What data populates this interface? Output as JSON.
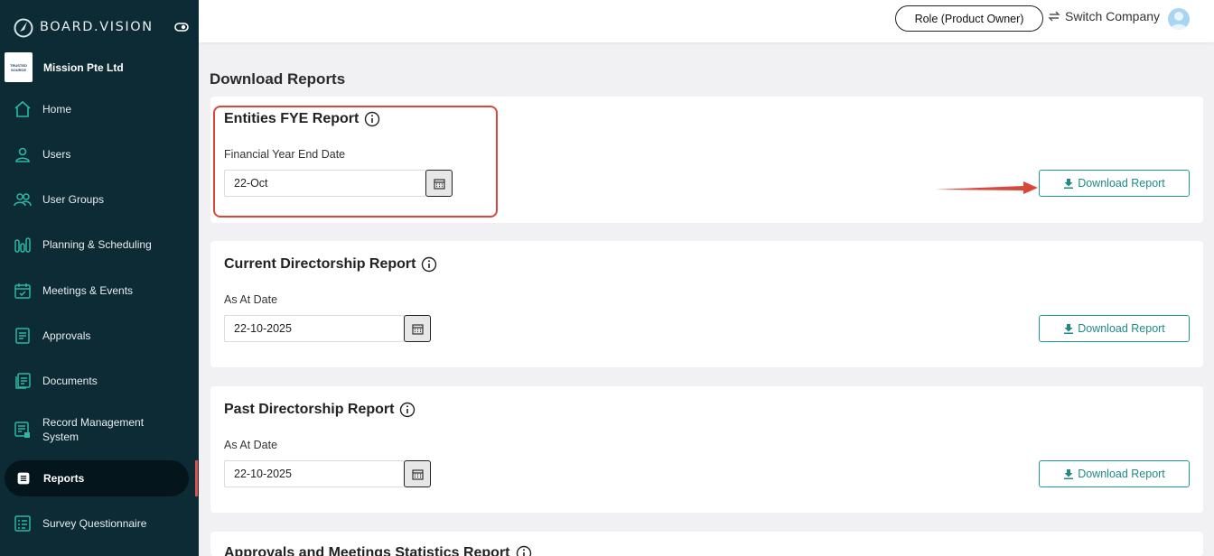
{
  "brand": {
    "name": "BOARD.VISION"
  },
  "company": {
    "name": "Mission Pte Ltd",
    "logo_text_1": "TRUSTED",
    "logo_text_2": "SOURCE"
  },
  "sidebar": {
    "items": [
      {
        "label": "Home",
        "icon": "home-icon"
      },
      {
        "label": "Users",
        "icon": "user-icon"
      },
      {
        "label": "User Groups",
        "icon": "user-group-icon"
      },
      {
        "label": "Planning & Scheduling",
        "icon": "bar-chart-icon"
      },
      {
        "label": "Meetings & Events",
        "icon": "calendar-check-icon"
      },
      {
        "label": "Approvals",
        "icon": "document-check-icon"
      },
      {
        "label": "Documents",
        "icon": "documents-icon"
      },
      {
        "label": "Record Management System",
        "label_line1": "Record Management",
        "label_line2": "System",
        "icon": "record-icon"
      },
      {
        "label": "Reports",
        "icon": "reports-icon",
        "active": true
      },
      {
        "label": "Survey Questionnaire",
        "icon": "survey-icon"
      }
    ]
  },
  "topbar": {
    "role_label": "Role (Product Owner)",
    "switch_label": "Switch Company"
  },
  "main": {
    "title": "Download Reports",
    "reports": [
      {
        "title": "Entities FYE Report",
        "field_label": "Financial Year End Date",
        "value": "22-Oct",
        "button": "Download Report"
      },
      {
        "title": "Current Directorship Report",
        "field_label": "As At Date",
        "value": "22-10-2025",
        "button": "Download Report"
      },
      {
        "title": "Past Directorship Report",
        "field_label": "As At Date",
        "value": "22-10-2025",
        "button": "Download Report"
      },
      {
        "title": "Approvals and Meetings Statistics Report"
      }
    ]
  },
  "colors": {
    "sidebar_bg": "#0d2b35",
    "accent": "#1f9a92",
    "annotation": "#d9473b"
  }
}
